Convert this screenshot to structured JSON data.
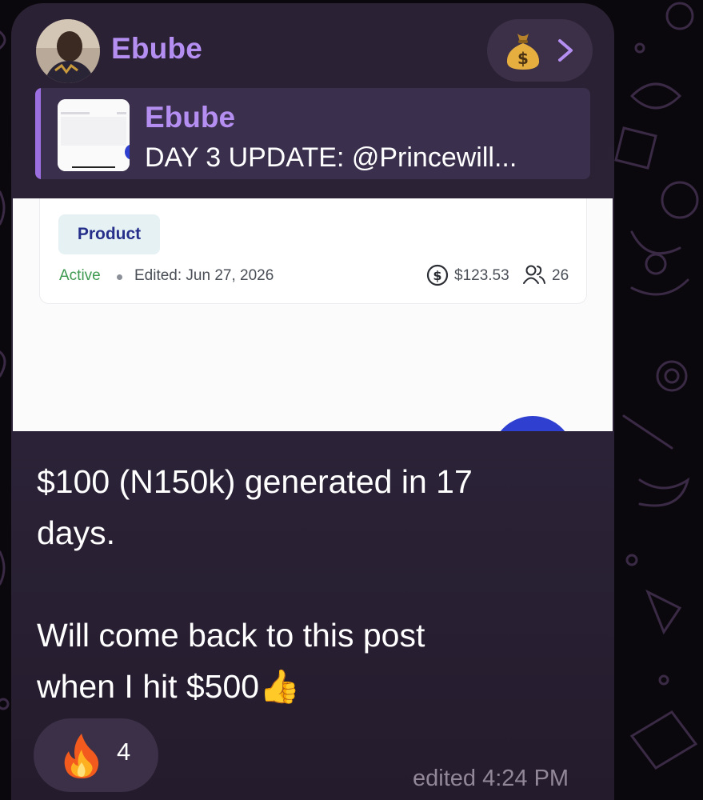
{
  "message": {
    "sender_name": "Ebube",
    "action_icon": "moneybag-icon",
    "reply": {
      "sender_name": "Ebube",
      "preview_text": "DAY 3 UPDATE: @Princewill..."
    },
    "media_preview": {
      "tag_label": "Product",
      "status": "Active",
      "edited_date": "Edited: Jun 27, 2026",
      "amount": "$123.53",
      "users_count": "26"
    },
    "text": "$100 (N150k) generated in 17\ndays.\n\nWill come back to this post\nwhen I hit $500👍",
    "reaction": {
      "emoji_icon": "fire-icon",
      "count": "4"
    },
    "edited_time": "edited 4:24 PM"
  },
  "colors": {
    "accent": "#b58ef2",
    "bubble": "#2b2134",
    "pill": "#3b3047",
    "active_status": "#3f9a52"
  }
}
